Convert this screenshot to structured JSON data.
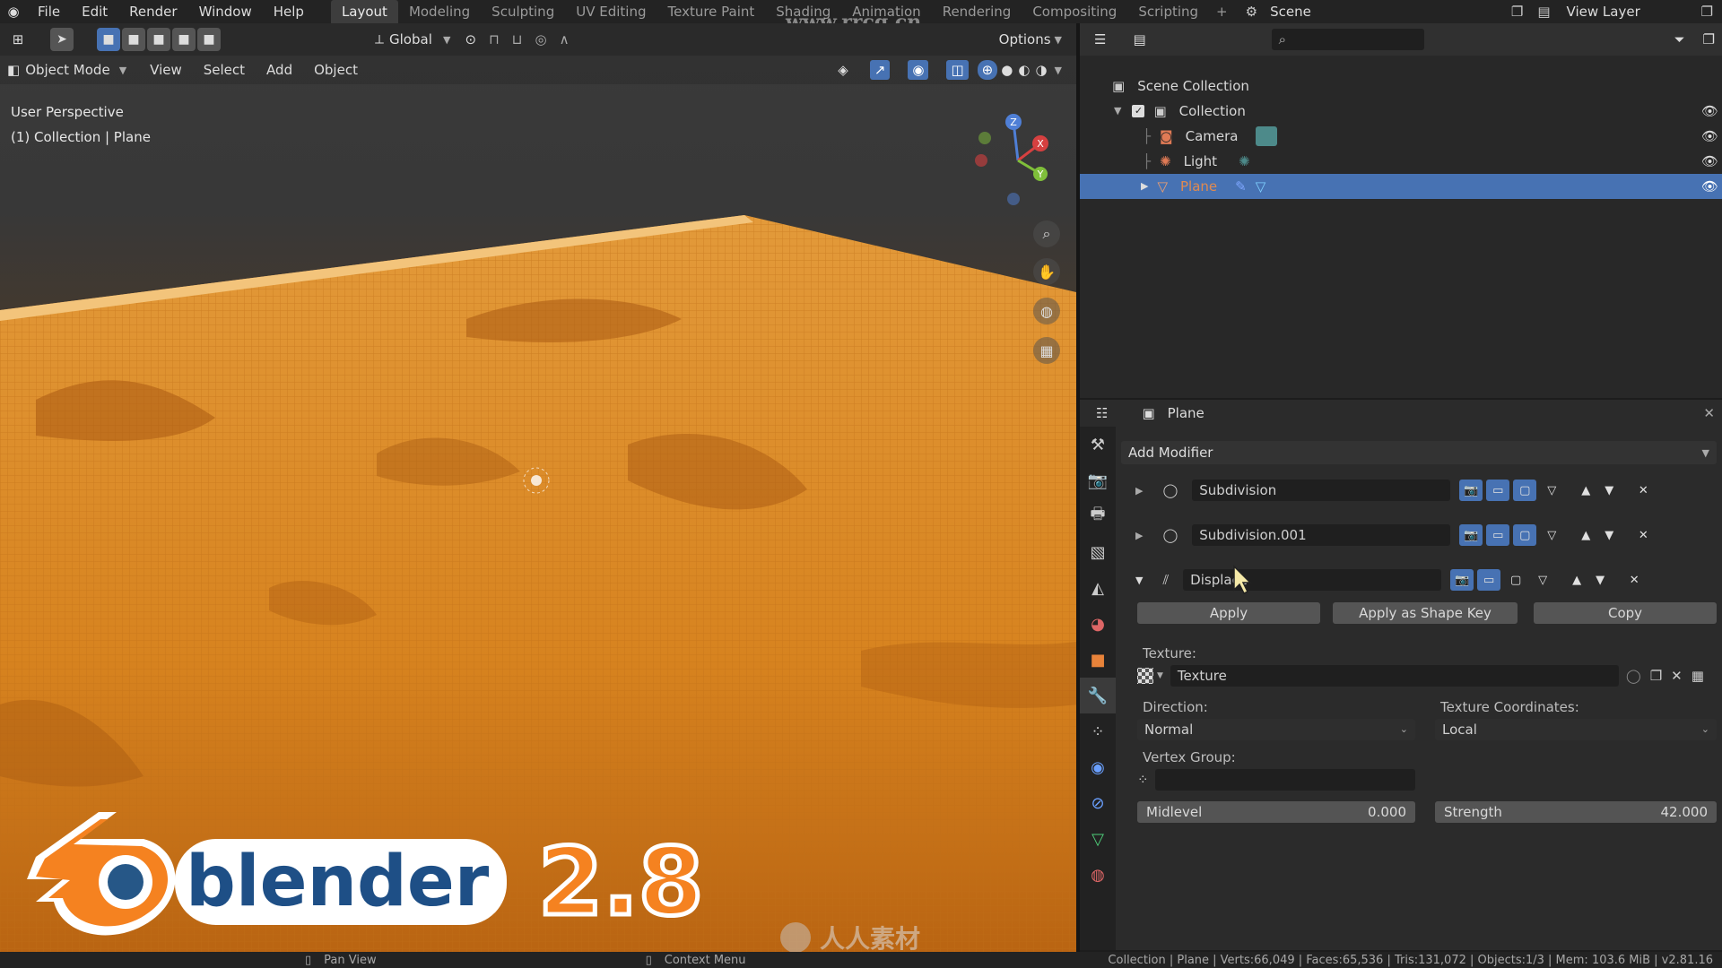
{
  "watermark": {
    "top": "www.rrcg.cn",
    "bottom": "人人素材"
  },
  "topbar": {
    "menus": [
      "File",
      "Edit",
      "Render",
      "Window",
      "Help"
    ],
    "workspaces": [
      "Layout",
      "Modeling",
      "Sculpting",
      "UV Editing",
      "Texture Paint",
      "Shading",
      "Animation",
      "Rendering",
      "Compositing",
      "Scripting"
    ],
    "active_workspace": "Layout",
    "scene": "Scene",
    "view_layer": "View Layer"
  },
  "viewport": {
    "transform_orientation": "Global",
    "options_label": "Options",
    "mode": "Object Mode",
    "menus": [
      "View",
      "Select",
      "Add",
      "Object"
    ],
    "perspective_label": "User Perspective",
    "collection_label": "(1) Collection | Plane",
    "gizmo_axes": {
      "x": "X",
      "y": "Y",
      "z": "Z"
    }
  },
  "outliner": {
    "root": "Scene Collection",
    "collection": "Collection",
    "items": [
      {
        "label": "Camera"
      },
      {
        "label": "Light"
      },
      {
        "label": "Plane"
      }
    ],
    "selected": "Plane"
  },
  "properties": {
    "object_name": "Plane",
    "add_modifier_label": "Add Modifier",
    "modifiers": [
      {
        "name": "Subdivision"
      },
      {
        "name": "Subdivision.001"
      },
      {
        "name": "Displace"
      }
    ],
    "apply_label": "Apply",
    "apply_shape_key_label": "Apply as Shape Key",
    "copy_label": "Copy",
    "texture_label": "Texture:",
    "texture_value": "Texture",
    "direction_label": "Direction:",
    "direction_value": "Normal",
    "texture_coords_label": "Texture Coordinates:",
    "texture_coords_value": "Local",
    "vertex_group_label": "Vertex Group:",
    "midlevel_label": "Midlevel",
    "midlevel_value": "0.000",
    "strength_label": "Strength",
    "strength_value": "42.000"
  },
  "statusbar": {
    "left_label": "Pan View",
    "mid_label": "Context Menu",
    "stats": "Collection | Plane | Verts:66,049 | Faces:65,536 | Tris:131,072 | Objects:1/3 | Mem: 103.6 MiB | v2.81.16"
  },
  "logo": {
    "word": "blender",
    "version": "2.8"
  },
  "colors": {
    "accent": "#4772b3",
    "terrain": "#e8942a",
    "logo_orange": "#f58220",
    "logo_blue": "#265787"
  }
}
